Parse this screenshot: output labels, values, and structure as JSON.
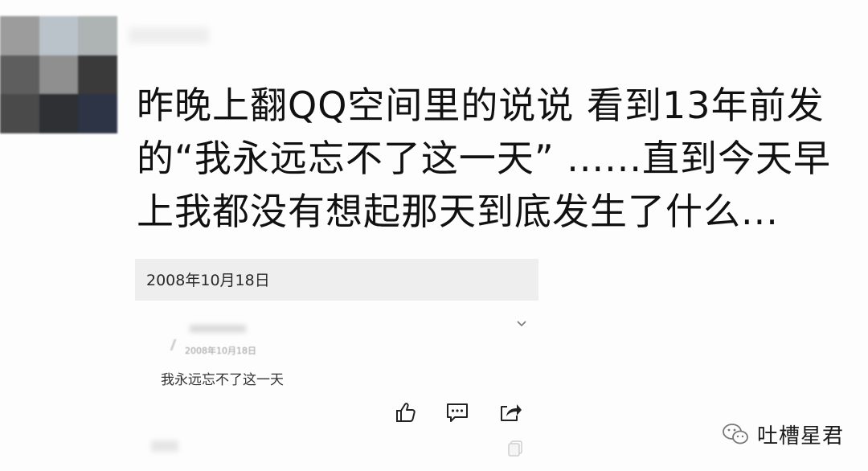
{
  "post": {
    "line1": "昨晚上翻QQ空间里的说说 看到13年前发",
    "line2": "的“我永远忘不了这一天” ......直到今天早",
    "line3": "上我都没有想起那天到底发生了什么..."
  },
  "date_header": "2008年10月18日",
  "card": {
    "date": "2008年10月18日",
    "text": "我永远忘不了这一天"
  },
  "watermark": {
    "text": "吐槽星君"
  },
  "avatar_colors": [
    "#9c9c9c",
    "#b9c3c9",
    "#aeb3b3",
    "#5e5e5e",
    "#8f8f8f",
    "#3a3a3a",
    "#4a4a4a",
    "#2e3033",
    "#2c3446"
  ],
  "icons": [
    "like-icon",
    "comment-icon",
    "share-icon",
    "chevron-down-icon",
    "copy-icon"
  ]
}
